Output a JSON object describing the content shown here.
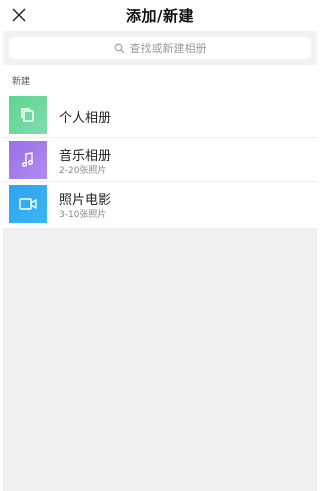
{
  "header": {
    "title": "添加/新建"
  },
  "search": {
    "placeholder": "查找或新建相册"
  },
  "section": {
    "label": "新建"
  },
  "items": [
    {
      "title": "个人相册",
      "subtitle": "",
      "icon": "album-copy-icon",
      "color": "#6fd8a0"
    },
    {
      "title": "音乐相册",
      "subtitle": "2-20张照片",
      "icon": "music-note-icon",
      "color": "#a47ceb"
    },
    {
      "title": "照片电影",
      "subtitle": "3-10张照片",
      "icon": "video-camera-icon",
      "color": "#34aef3"
    }
  ]
}
